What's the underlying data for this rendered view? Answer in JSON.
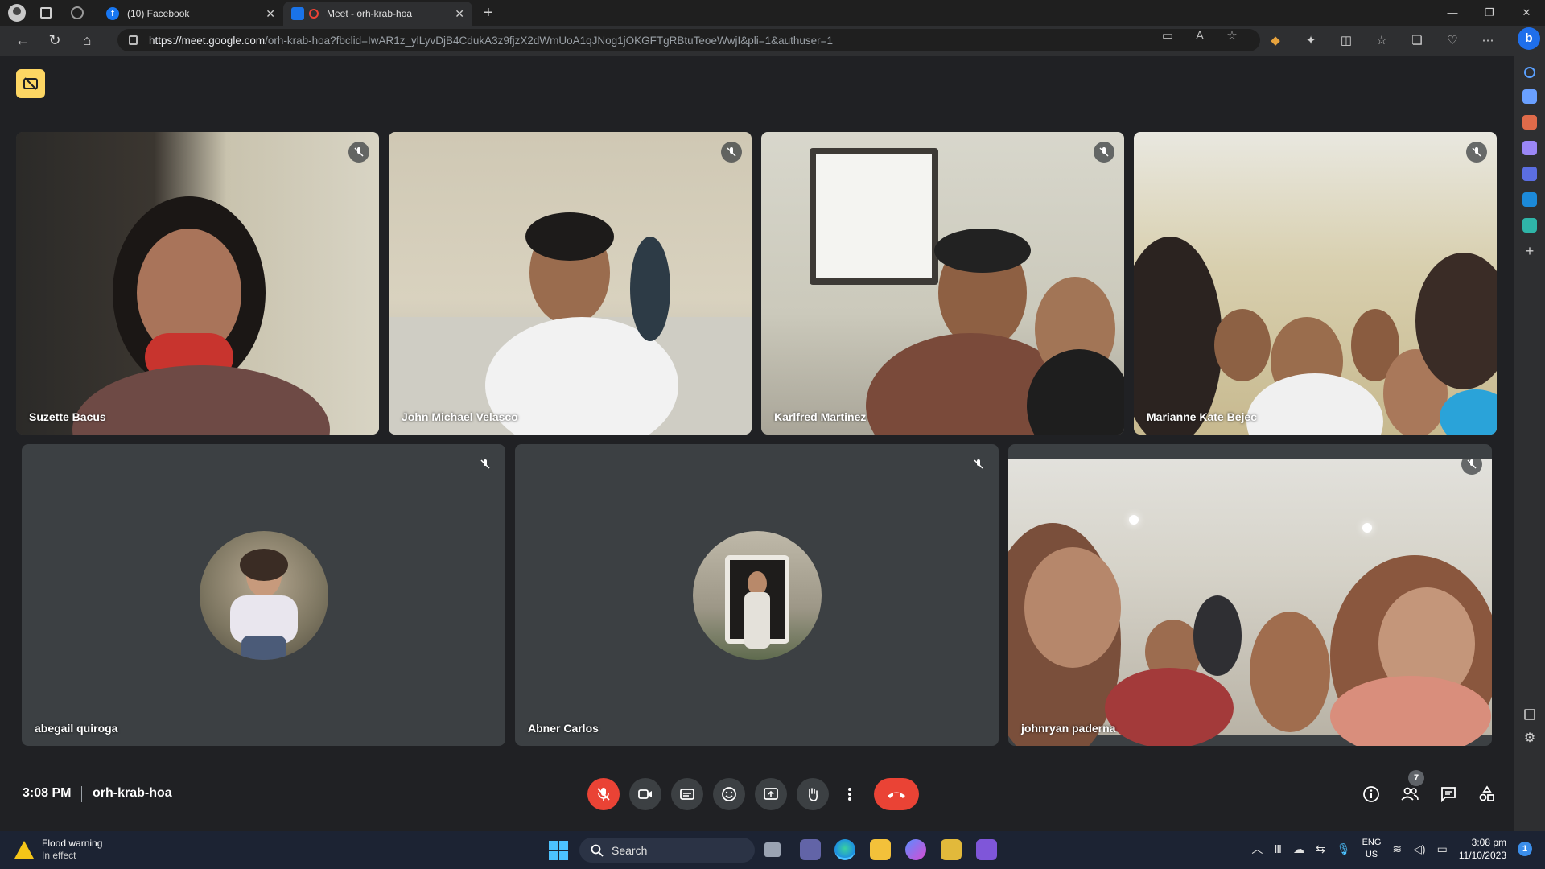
{
  "browser": {
    "tabs": [
      {
        "title": "(10) Facebook",
        "active": false
      },
      {
        "title": "Meet - orh-krab-hoa",
        "active": true
      }
    ],
    "url_host": "https://meet.google.com",
    "url_rest": "/orh-krab-hoa?fbclid=IwAR1z_ylLyvDjB4CdukA3z9fjzX2dWmUoA1qJNog1jOKGFTgRBtuTeoeWwjI&pli=1&authuser=1"
  },
  "meeting": {
    "time": "3:08 PM",
    "code": "orh-krab-hoa",
    "participant_count": "7"
  },
  "participants": [
    {
      "name": "Suzette Bacus",
      "muted": true,
      "video": true
    },
    {
      "name": "John Michael Velasco",
      "muted": true,
      "video": true
    },
    {
      "name": "Karlfred Martinez",
      "muted": true,
      "video": true
    },
    {
      "name": "Marianne Kate Bejec",
      "muted": true,
      "video": true
    },
    {
      "name": "abegail quiroga",
      "muted": true,
      "video": false
    },
    {
      "name": "Abner Carlos",
      "muted": true,
      "video": false
    },
    {
      "name": "johnryan paderna",
      "muted": true,
      "video": true
    }
  ],
  "taskbar": {
    "weather_title": "Flood warning",
    "weather_sub": "In effect",
    "search_label": "Search",
    "lang_top": "ENG",
    "lang_bottom": "US",
    "time": "3:08 pm",
    "date": "11/10/2023",
    "notification_count": "1"
  },
  "colors": {
    "meet_bg": "#202124",
    "tile_bg": "#3c4043",
    "danger": "#ea4335",
    "caption_badge": "#fdd663"
  }
}
